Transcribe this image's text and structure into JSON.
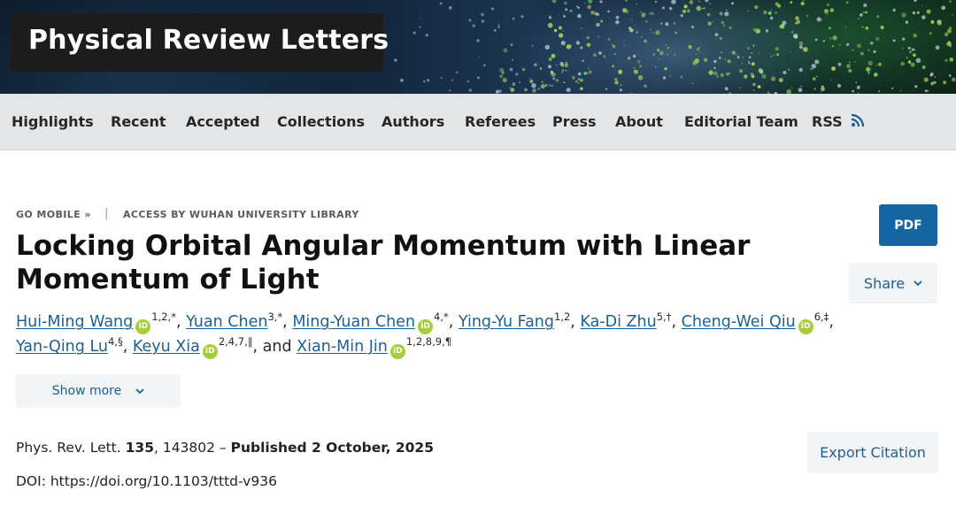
{
  "journal": {
    "title": "Physical Review Letters"
  },
  "nav": {
    "items": [
      "Highlights",
      "Recent",
      "Accepted",
      "Collections",
      "Authors",
      "Referees",
      "Press",
      "About",
      "Editorial Team",
      "RSS"
    ]
  },
  "access": {
    "go_mobile": "GO MOBILE »",
    "separator": "|",
    "access_by": "ACCESS BY WUHAN UNIVERSITY LIBRARY"
  },
  "article": {
    "title_line1": "Locking Orbital Angular Momentum with Linear",
    "title_line2": "Momentum of Light"
  },
  "buttons": {
    "pdf": "PDF",
    "share": "Share",
    "show_more": "Show more",
    "export_citation": "Export Citation"
  },
  "authors": [
    {
      "name": "Hui-Ming Wang",
      "orcid": true,
      "affil": "1,2,*"
    },
    {
      "name": "Yuan Chen",
      "orcid": false,
      "affil": "3,*"
    },
    {
      "name": "Ming-Yuan Chen",
      "orcid": true,
      "affil": "4,*"
    },
    {
      "name": "Ying-Yu Fang",
      "orcid": false,
      "affil": "1,2"
    },
    {
      "name": "Ka-Di Zhu",
      "orcid": false,
      "affil": "5,†"
    },
    {
      "name": "Cheng-Wei Qiu",
      "orcid": true,
      "affil": "6,‡"
    },
    {
      "name": "Yan-Qing Lu",
      "orcid": false,
      "affil": "4,§"
    },
    {
      "name": "Keyu Xia",
      "orcid": true,
      "affil": "2,4,7,∥"
    },
    {
      "name": "Xian-Min Jin",
      "orcid": true,
      "affil": "1,2,8,9,¶"
    }
  ],
  "authors_conjunction": "and",
  "citation": {
    "journal": "Phys. Rev. Lett.",
    "volume": "135",
    "article_number": ", 143802 – ",
    "published": "Published 2 October, 2025"
  },
  "doi": "DOI: https://doi.org/10.1103/tttd-v936",
  "icons": {
    "orcid": "orcid-icon",
    "rss": "rss-icon",
    "chevron": "chevron-down-icon"
  },
  "colors": {
    "link": "#1c5f95",
    "pdf_button": "#1565a3",
    "orcid": "#a6ce39"
  }
}
